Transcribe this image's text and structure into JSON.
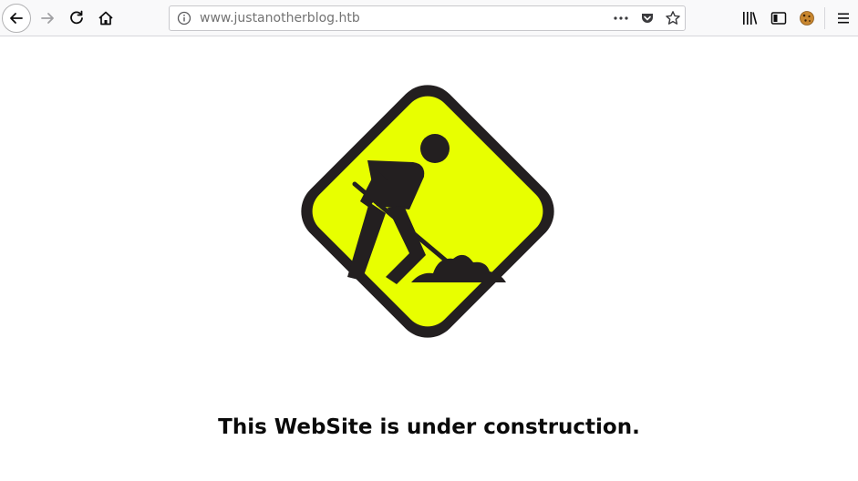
{
  "browser": {
    "url": {
      "host": "www.justanotherblog.htb"
    },
    "icons": {
      "back": "arrow-left-icon",
      "forward": "arrow-right-icon",
      "reload": "reload-icon",
      "home": "home-icon",
      "site_info": "info-icon",
      "page_actions": "ellipsis-icon",
      "pocket": "pocket-icon",
      "bookmark": "star-icon",
      "library": "library-icon",
      "sidebar": "sidebar-icon",
      "cookie_extension": "cookie-icon",
      "menu": "hamburger-menu-icon"
    }
  },
  "page": {
    "headline": "This WebSite is under construction.",
    "sign_icon": "under-construction-worker-sign",
    "colors": {
      "sign_fill": "#e8ff00",
      "sign_border": "#231f20",
      "text": "#0a0a0a"
    }
  }
}
